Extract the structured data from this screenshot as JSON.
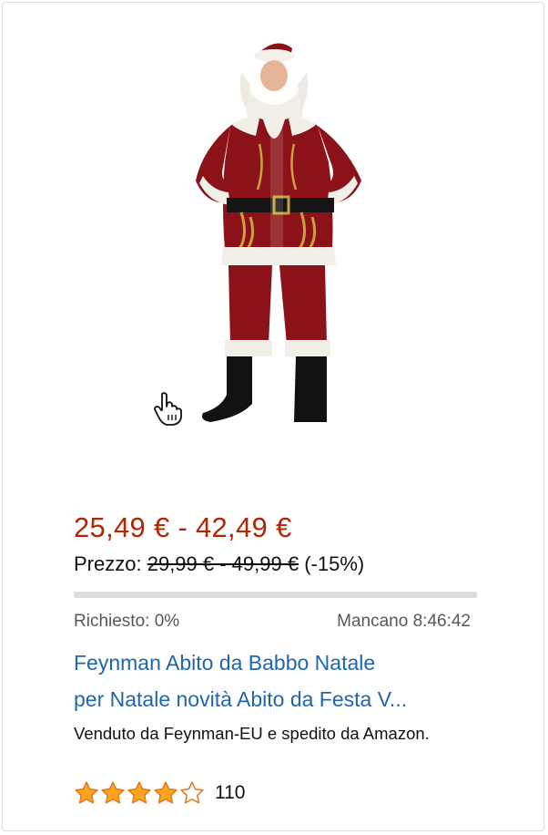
{
  "product": {
    "price_range": "25,49 € - 42,49 €",
    "list_price_label": "Prezzo:",
    "list_price_value": "29,99 € - 49,99 €",
    "discount": "(-15%)",
    "claimed_label": "Richiesto: 0%",
    "claimed_percent": 0,
    "timer_label": "Mancano 8:46:42",
    "title_line1": "Feynman Abito da Babbo Natale",
    "title_line2": "per Natale novità Abito da Festa V...",
    "seller": "Venduto da Feynman-EU e spedito da Amazon.",
    "rating_stars": 4,
    "rating_max": 5,
    "review_count": "110"
  },
  "colors": {
    "price": "#b12704",
    "link": "#1f65b0",
    "star_fill": "#ffa41c",
    "star_outline": "#de7921"
  },
  "icons": {
    "cursor": "hand-pointer-icon",
    "star": "star-icon"
  }
}
